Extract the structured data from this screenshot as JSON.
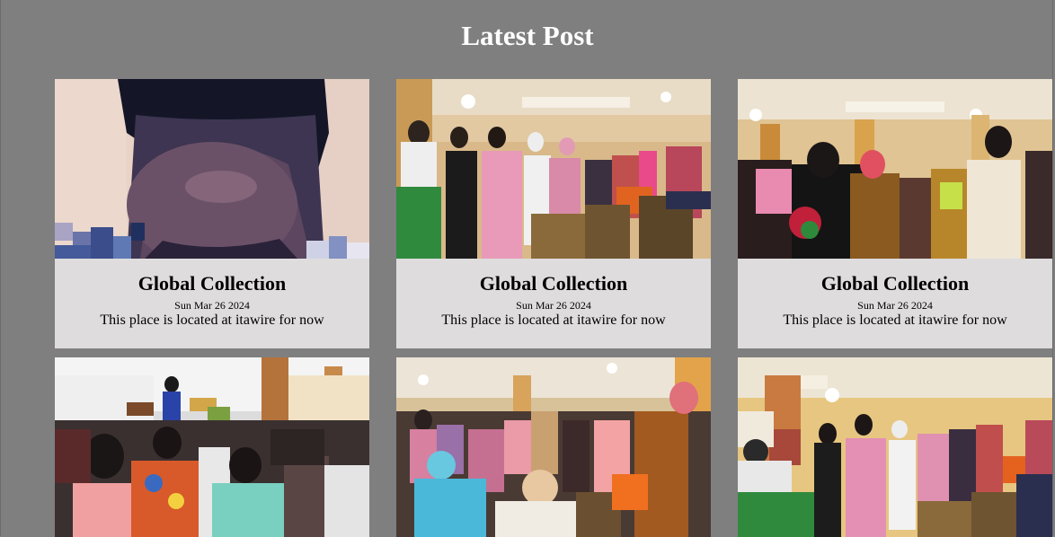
{
  "page": {
    "title": "Latest Post"
  },
  "colors": {
    "background": "#7f7f7f",
    "card_background": "#dedcdd",
    "title_text": "#ffffff"
  },
  "posts": [
    {
      "title": "Global Collection",
      "date": "Sun Mar 26 2024",
      "description": "This place is located at itawire for now",
      "image": "close-up-head-photo"
    },
    {
      "title": "Global Collection",
      "date": "Sun Mar 26 2024",
      "description": "This place is located at itawire for now",
      "image": "hall-crowd-photo"
    },
    {
      "title": "Global Collection",
      "date": "Sun Mar 26 2024",
      "description": "This place is located at itawire for now",
      "image": "hall-crowd-photo"
    },
    {
      "title": "",
      "date": "",
      "description": "",
      "image": "church-hall-seated-photo"
    },
    {
      "title": "",
      "date": "",
      "description": "",
      "image": "hall-crowd-photo"
    },
    {
      "title": "",
      "date": "",
      "description": "",
      "image": "hall-crowd-photo"
    }
  ]
}
